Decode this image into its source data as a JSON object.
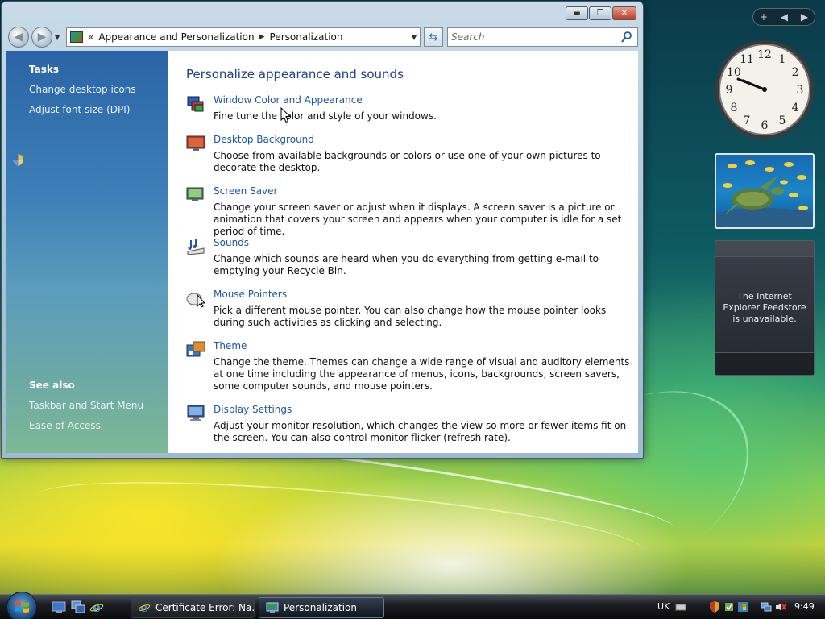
{
  "window": {
    "controls": {
      "minimize": "▬",
      "maximize": "❐",
      "close": "✕"
    },
    "address": {
      "prefix": "«",
      "crumbs": [
        "Appearance and Personalization",
        "Personalization"
      ],
      "separator": "▶"
    },
    "search": {
      "placeholder": "Search"
    }
  },
  "sidebar": {
    "tasks_heading": "Tasks",
    "tasks": [
      {
        "label": "Change desktop icons"
      },
      {
        "label": "Adjust font size (DPI)"
      }
    ],
    "see_also_heading": "See also",
    "see_also": [
      {
        "label": "Taskbar and Start Menu"
      },
      {
        "label": "Ease of Access"
      }
    ]
  },
  "main": {
    "title": "Personalize appearance and sounds",
    "items": [
      {
        "title": "Window Color and Appearance",
        "desc": "Fine tune the color and style of your windows.",
        "icon": "window-color-icon"
      },
      {
        "title": "Desktop Background",
        "desc": "Choose from available backgrounds or colors or use one of your own pictures to decorate the desktop.",
        "icon": "desktop-background-icon"
      },
      {
        "title": "Screen Saver",
        "desc": "Change your screen saver or adjust when it displays. A screen saver is a picture or animation that covers your screen and appears when your computer is idle for a set period of time.",
        "icon": "screen-saver-icon"
      },
      {
        "title": "Sounds",
        "desc": "Change which sounds are heard when you do everything from getting e-mail to emptying your Recycle Bin.",
        "icon": "sounds-icon"
      },
      {
        "title": "Mouse Pointers",
        "desc": "Pick a different mouse pointer. You can also change how the mouse pointer looks during such activities as clicking and selecting.",
        "icon": "mouse-pointers-icon"
      },
      {
        "title": "Theme",
        "desc": "Change the theme. Themes can change a wide range of visual and auditory elements at one time including the appearance of menus, icons, backgrounds, screen savers, some computer sounds, and mouse pointers.",
        "icon": "theme-icon"
      },
      {
        "title": "Display Settings",
        "desc": "Adjust your monitor resolution, which changes the view so more or fewer items fit on the screen. You can also control monitor flicker (refresh rate).",
        "icon": "display-settings-icon"
      }
    ]
  },
  "gadgets": {
    "bar": {
      "add": "+",
      "prev": "◀",
      "next": "▶"
    },
    "clock": {
      "time": "9:49",
      "numerals": [
        "12",
        "1",
        "2",
        "3",
        "4",
        "5",
        "6",
        "7",
        "8",
        "9",
        "10",
        "11"
      ]
    },
    "feed_message": "The Internet Explorer Feedstore is unavailable."
  },
  "taskbar": {
    "buttons": [
      {
        "label": "Certificate Error: Na...",
        "active": false
      },
      {
        "label": "Personalization",
        "active": true
      }
    ],
    "tray": {
      "language": "UK",
      "clock": "9:49"
    }
  }
}
